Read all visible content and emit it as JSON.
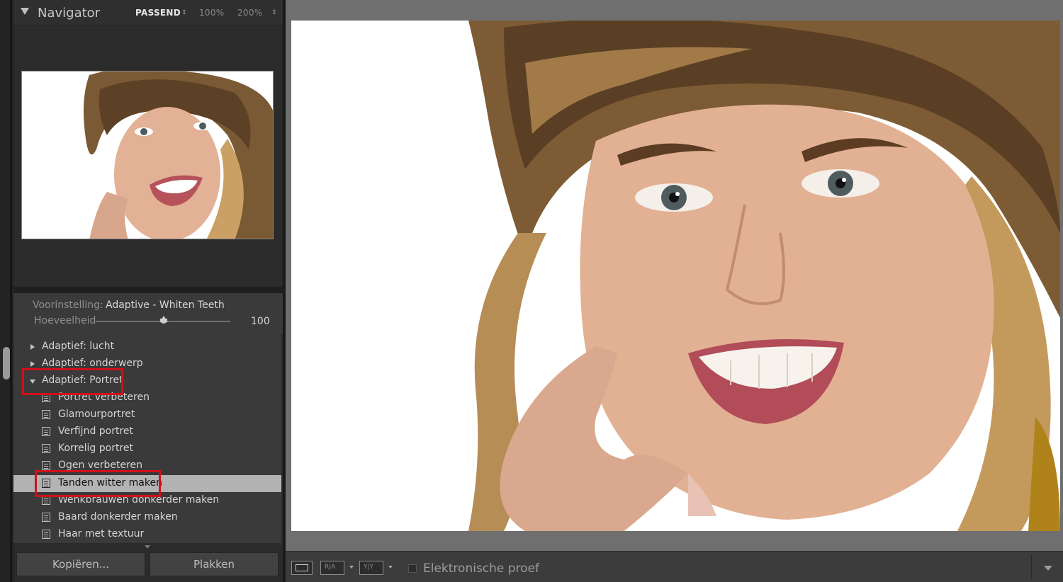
{
  "navigator": {
    "title": "Navigator",
    "zoom_fit": "PASSEND",
    "zoom_fit_arrow": "⇕",
    "zoom_100": "100%",
    "zoom_200": "200%",
    "zoom_more_arrow": "⇕"
  },
  "preset": {
    "label": "Voorinstelling:",
    "name": "Adaptive - Whiten Teeth",
    "amount_label": "Hoeveelheid",
    "amount_value": "100",
    "amount_fraction": 0.48
  },
  "preset_list": [
    {
      "label": "Adaptief: lucht",
      "kind": "group",
      "state": "collapsed"
    },
    {
      "label": "Adaptief: onderwerp",
      "kind": "group",
      "state": "collapsed"
    },
    {
      "label": "Adaptief: Portret",
      "kind": "group",
      "state": "expanded"
    },
    {
      "label": "Portret verbeteren",
      "kind": "item"
    },
    {
      "label": "Glamourportret",
      "kind": "item"
    },
    {
      "label": "Verfijnd portret",
      "kind": "item"
    },
    {
      "label": "Korrelig portret",
      "kind": "item"
    },
    {
      "label": "Ogen verbeteren",
      "kind": "item"
    },
    {
      "label": "Tanden witter maken",
      "kind": "item",
      "selected": true
    },
    {
      "label": "Wenkbrauwen donkerder maken",
      "kind": "item"
    },
    {
      "label": "Baard donkerder maken",
      "kind": "item"
    },
    {
      "label": "Haar met textuur",
      "kind": "item"
    }
  ],
  "buttons": {
    "copy": "Kopiëren...",
    "paste": "Plakken"
  },
  "toolbar": {
    "ra_label": "R|A",
    "yy_label": "Y|Y",
    "soft_proof_label": "Elektronische proef"
  },
  "colors": {
    "highlight": "#d0101a",
    "selected_row": "#b3b3b3",
    "panel": "#2b2b2b",
    "canvas": "#6f6f6f"
  },
  "icons": [
    "disclosure-triangle-icon",
    "preset-icon",
    "loupe-view-icon",
    "before-after-icon",
    "chevron-down-icon"
  ]
}
